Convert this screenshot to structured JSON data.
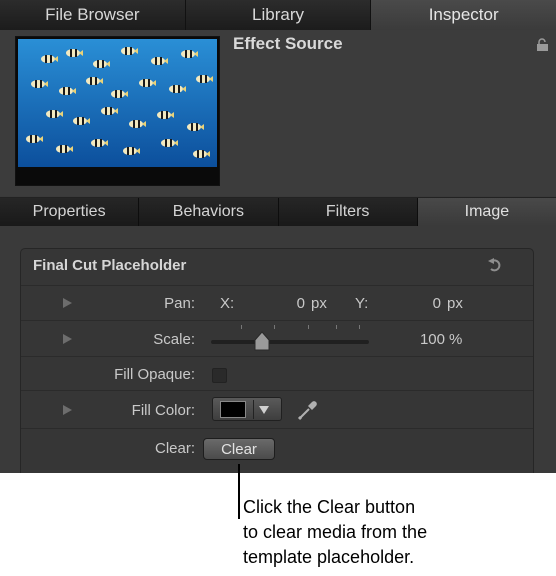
{
  "tabs": {
    "top": [
      "File Browser",
      "Library",
      "Inspector"
    ],
    "active_top": "Inspector"
  },
  "header": {
    "title": "Effect Source",
    "lock_icon": "lock-icon"
  },
  "subtabs": {
    "items": [
      "Properties",
      "Behaviors",
      "Filters",
      "Image"
    ],
    "active": "Image"
  },
  "group": {
    "title": "Final Cut Placeholder",
    "pan": {
      "label": "Pan:",
      "x_label": "X:",
      "x_value": "0",
      "x_unit": "px",
      "y_label": "Y:",
      "y_value": "0",
      "y_unit": "px"
    },
    "scale": {
      "label": "Scale:",
      "value": "100",
      "unit": "%",
      "slider_fraction": 0.3
    },
    "fill_opaque": {
      "label": "Fill Opaque:",
      "checked": false
    },
    "fill_color": {
      "label": "Fill Color:",
      "color": "#000000"
    },
    "clear": {
      "label": "Clear:",
      "button": "Clear"
    }
  },
  "callout": {
    "line1": "Click the Clear button",
    "line2": "to clear media from the",
    "line3": "template placeholder."
  }
}
